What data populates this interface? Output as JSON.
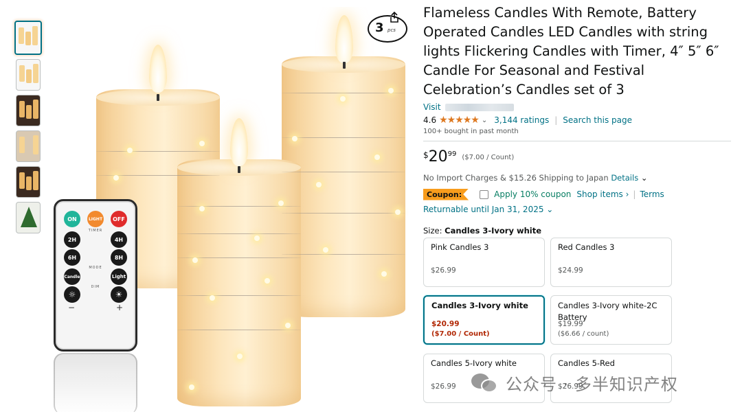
{
  "product": {
    "title": "Flameless Candles With Remote, Battery Operated Candles LED Candles with string lights Flickering Candles with Timer, 4″ 5″ 6″ Candle For Seasonal and Festival Celebration’s Candles set of 3",
    "visit_label": "Visit",
    "rating_value": "4.6",
    "stars_display": "★★★★★",
    "rating_chevron": "⌄",
    "ratings_count": "3,144 ratings",
    "search_page": "Search this page",
    "bought": "100+ bought in past month"
  },
  "price": {
    "symbol": "$",
    "whole": "20",
    "fraction": "99",
    "unit": "($7.00 / Count)"
  },
  "shipping": {
    "text": "No Import Charges & $15.26 Shipping to Japan",
    "details_label": "Details",
    "chevron": "⌄"
  },
  "coupon": {
    "badge": "Coupon:",
    "apply_text": "Apply 10% coupon",
    "shop_items": "Shop items ›",
    "separator": "|",
    "terms": "Terms"
  },
  "returnable": "Returnable until Jan 31, 2025 ⌄",
  "size": {
    "label": "Size:",
    "selected": "Candles 3-Ivory white"
  },
  "swatches": [
    {
      "name": "Pink Candles 3",
      "price": "$26.99"
    },
    {
      "name": "Red Candles 3",
      "price": "$24.99"
    },
    {
      "name": "Candles 3-Ivory white",
      "price": "$20.99",
      "unit": "($7.00 / Count)",
      "selected": true
    },
    {
      "name": "Candles 3-Ivory white-2C Battery",
      "price": "$19.99",
      "unit": "($6.66 / count)"
    },
    {
      "name": "Candles 5-Ivory white",
      "price": "$26.99"
    },
    {
      "name": "Candles 5-Red",
      "price": "$26.99"
    }
  ],
  "image_badge": {
    "number": "3",
    "label": "pcs"
  },
  "remote": {
    "on": "ON",
    "light": "LIGHT",
    "off": "OFF",
    "timer": "TIMER",
    "h2": "2H",
    "h4": "4H",
    "h6": "6H",
    "h8": "8H",
    "mode": "MODE",
    "candle": "Candle",
    "light_mode": "Light",
    "dim": "DIM",
    "minus": "−",
    "plus": "+"
  },
  "watermark": "公众号 · 多半知识产权",
  "colors": {
    "link": "#007185",
    "price_red": "#b12704",
    "coupon_orange": "#f89c1c",
    "star": "#de7921",
    "green": "#067d62"
  },
  "icons": [
    "share-icon",
    "star-icon",
    "chevron-down-icon",
    "checkbox-icon",
    "wechat-icon"
  ]
}
